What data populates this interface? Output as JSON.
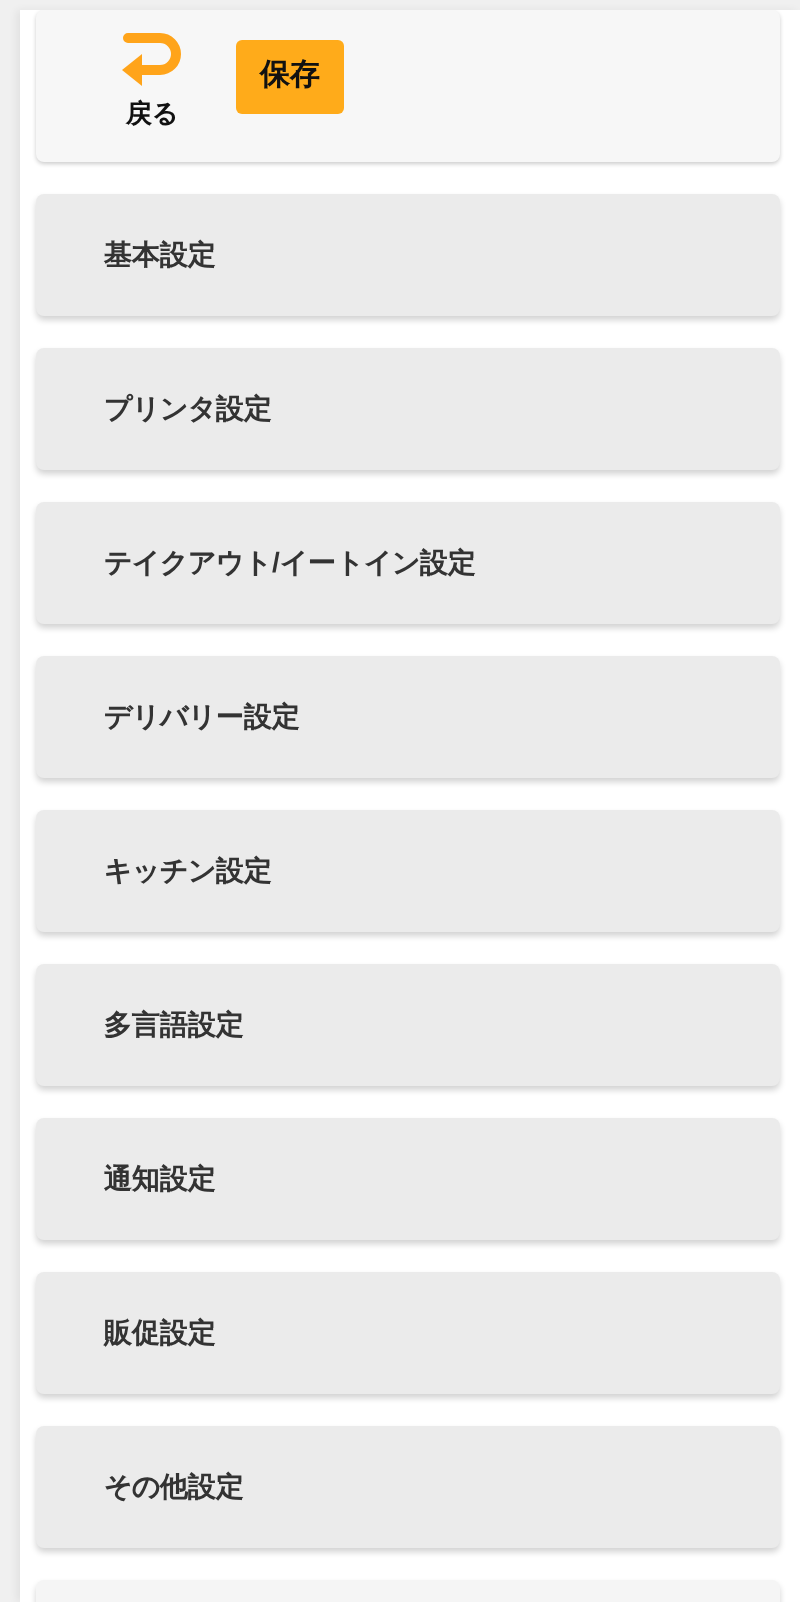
{
  "toolbar": {
    "back_label": "戻る",
    "save_label": "保存"
  },
  "menu_items": [
    {
      "label": "基本設定"
    },
    {
      "label": "プリンタ設定"
    },
    {
      "label": "テイクアウト/イートイン設定"
    },
    {
      "label": "デリバリー設定"
    },
    {
      "label": "キッチン設定"
    },
    {
      "label": "多言語設定"
    },
    {
      "label": "通知設定"
    },
    {
      "label": "販促設定"
    },
    {
      "label": "その他設定"
    }
  ]
}
